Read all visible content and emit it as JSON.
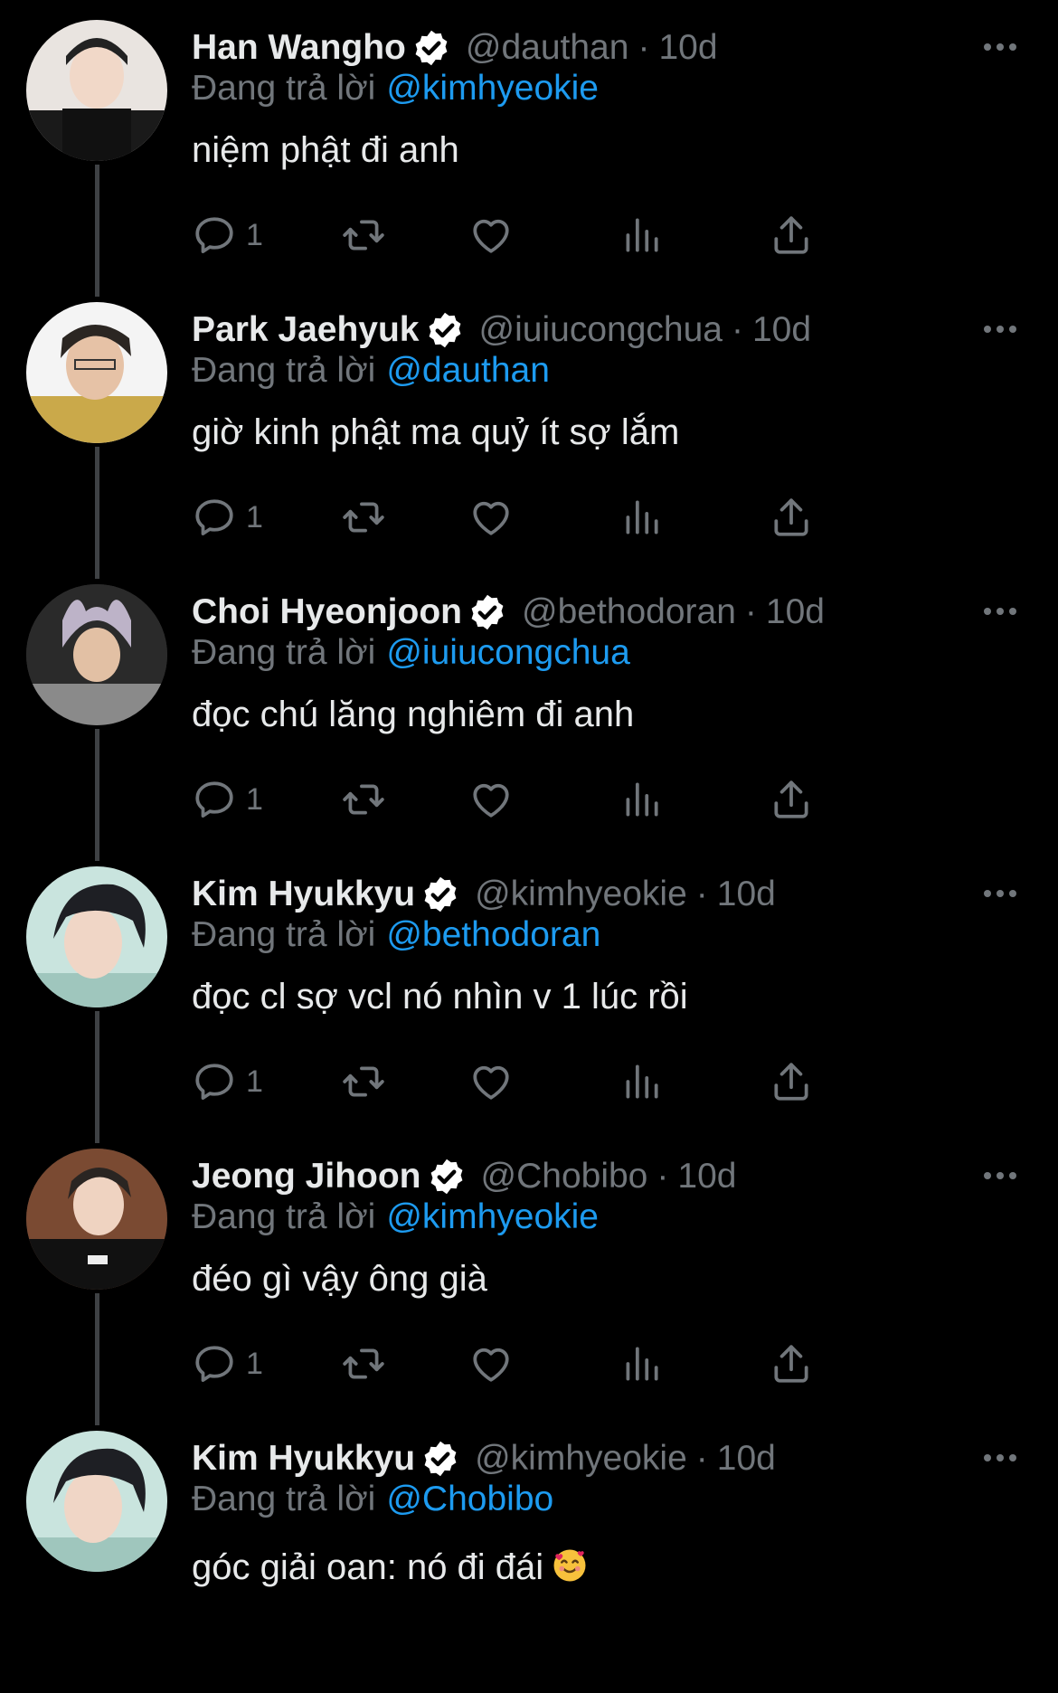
{
  "replying_prefix": "Đang trả lời",
  "colors": {
    "background": "#000000",
    "primary_text": "#e7e9ea",
    "secondary_text": "#71767b",
    "link": "#1d9bf0",
    "thread_line": "#3e4144"
  },
  "tweets": [
    {
      "name": "Han Wangho",
      "handle": "@dauthan",
      "time": "10d",
      "replying_to": "@kimhyeokie",
      "text": "niệm phật đi anh",
      "reply_count": "1"
    },
    {
      "name": "Park Jaehyuk",
      "handle": "@iuiucongchua",
      "time": "10d",
      "replying_to": "@dauthan",
      "text": "giờ kinh phật ma quỷ ít sợ lắm",
      "reply_count": "1"
    },
    {
      "name": "Choi Hyeonjoon",
      "handle": "@bethodoran",
      "time": "10d",
      "replying_to": "@iuiucongchua",
      "text": "đọc chú lăng nghiêm đi anh",
      "reply_count": "1"
    },
    {
      "name": "Kim Hyukkyu",
      "handle": "@kimhyeokie",
      "time": "10d",
      "replying_to": "@bethodoran",
      "text": "đọc cl sợ vcl nó nhìn v 1 lúc rồi",
      "reply_count": "1"
    },
    {
      "name": "Jeong Jihoon",
      "handle": "@Chobibo",
      "time": "10d",
      "replying_to": "@kimhyeokie",
      "text": "đéo gì vậy ông già",
      "reply_count": "1"
    },
    {
      "name": "Kim Hyukkyu",
      "handle": "@kimhyeokie",
      "time": "10d",
      "replying_to": "@Chobibo",
      "text": "góc giải oan: nó đi đái",
      "reply_count": ""
    }
  ],
  "icons": {
    "verified": "verified-badge-icon",
    "more": "more-options-icon",
    "reply": "reply-bubble-icon",
    "retweet": "retweet-icon",
    "like": "heart-icon",
    "views": "views-bar-chart-icon",
    "share": "share-icon",
    "emoji": "smiling-face-with-hearts-emoji"
  }
}
